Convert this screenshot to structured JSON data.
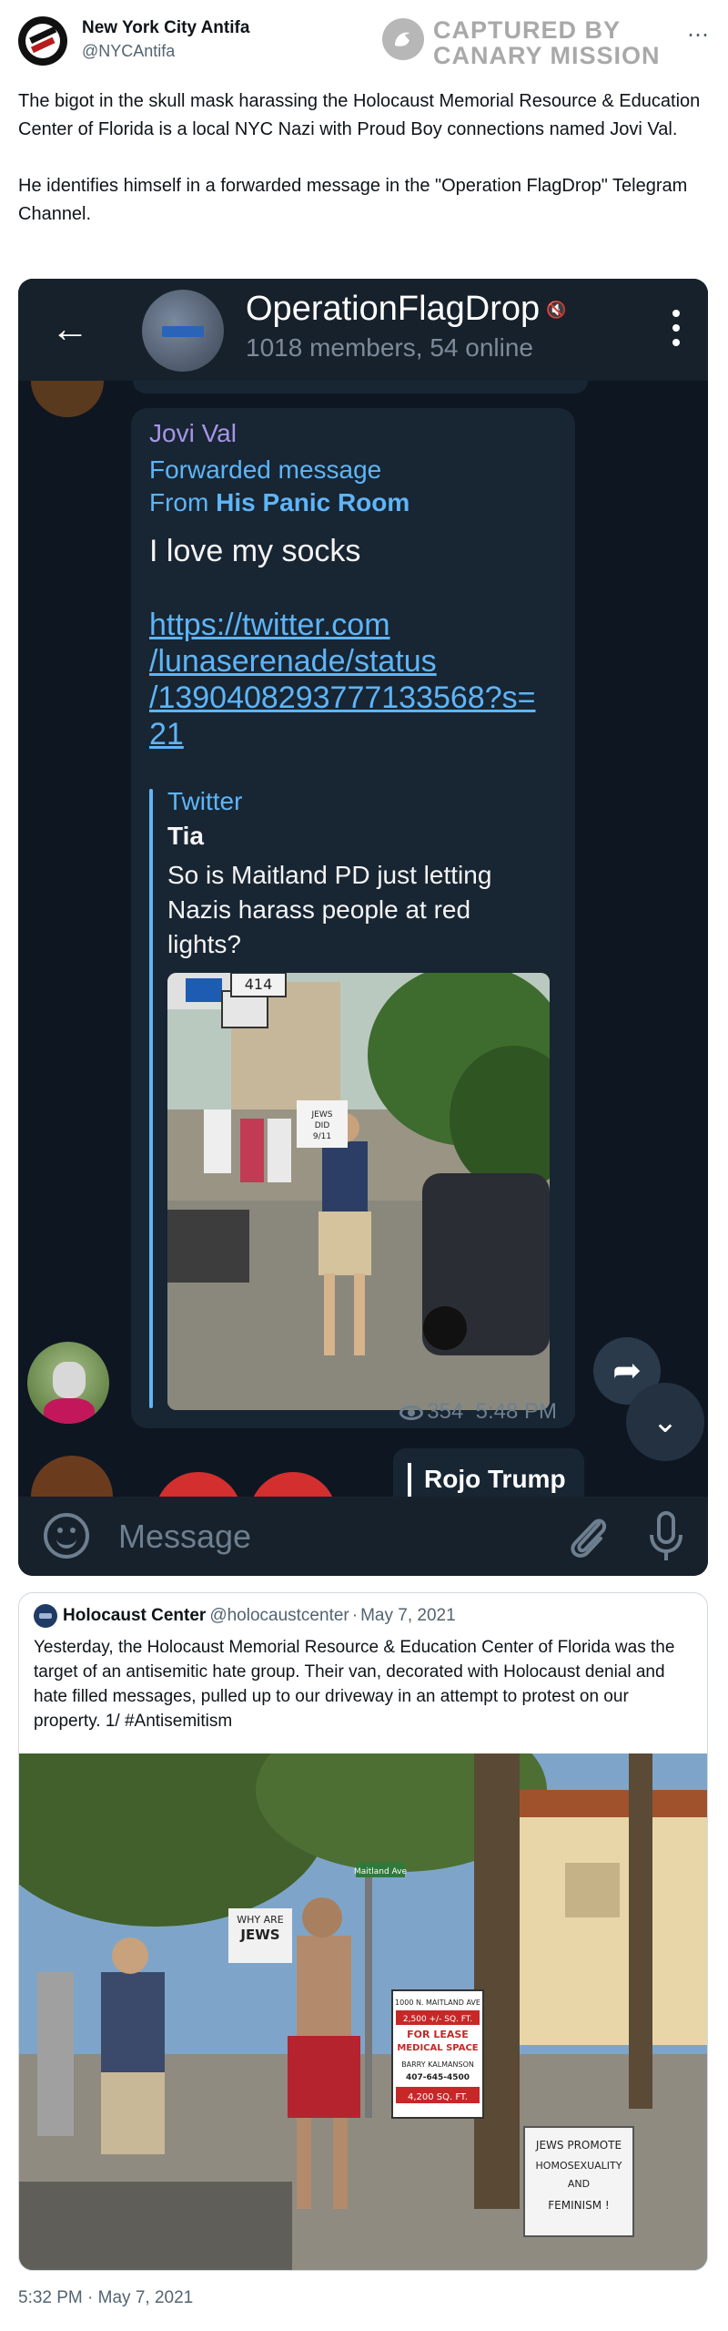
{
  "tweet": {
    "author_name": "New York City Antifa",
    "author_handle": "@NYCAntifa",
    "watermark_line1": "CAPTURED BY",
    "watermark_line2": "CANARY MISSION",
    "more_icon": "more-horizontal-icon",
    "paragraph1": "The bigot in the skull mask harassing the Holocaust Memorial Resource & Education Center of Florida is a local NYC Nazi with Proud Boy connections named Jovi Val.",
    "paragraph2": "He identifies himself in a forwarded message in the \"Operation FlagDrop\" Telegram Channel.",
    "time": "5:32 PM",
    "date_sep": " · ",
    "date": "May 7, 2021"
  },
  "telegram": {
    "back_icon": "arrow-left-icon",
    "group_title": "OperationFlagDrop",
    "group_subtitle": "1018 members, 54 online",
    "message": {
      "sender": "Jovi Val",
      "forwarded_label": "Forwarded message",
      "from_prefix": "From ",
      "from_name": "His Panic Room",
      "text": "I love my socks",
      "link_lines": [
        "https://twitter.com",
        "/lunaserenade/status",
        "/1390408293777133568?s=",
        "21"
      ],
      "preview": {
        "site": "Twitter",
        "name": "Tia",
        "description": "So is Maitland PD just letting Nazis harass people at red lights?",
        "photo_sign_line1": "JEWS",
        "photo_sign_line2": "DID",
        "photo_sign_line3": "9/11",
        "photo_road_sign": "414"
      },
      "views": "354",
      "time": "5:48 PM"
    },
    "next_message_preview": "Rojo Trump",
    "input_placeholder": "Message",
    "icons": [
      "emoji-icon",
      "paperclip-icon",
      "microphone-icon",
      "share-icon",
      "chevron-down-icon",
      "mute-icon"
    ]
  },
  "quoted_tweet": {
    "name": "Holocaust Center",
    "handle": "@holocaustcenter",
    "separator": "·",
    "date": "May 7, 2021",
    "text": "Yesterday, the Holocaust Memorial Resource & Education Center of Florida was the target of an antisemitic hate group. Their van, decorated with Holocaust denial and hate filled messages, pulled up to our driveway in an attempt to protest on our property. 1/ #Antisemitism",
    "photo": {
      "sign_why": "WHY ARE",
      "sign_jews": "JEWS",
      "street_sign": "Maitland Ave",
      "lease_sign_line1": "1000 N. MAITLAND AVE",
      "lease_sign_line2": "2,500 +/- SQ. FT.",
      "lease_sign_line3": "FOR LEASE",
      "lease_sign_line4": "MEDICAL SPACE",
      "lease_sign_line5": "BARRY KALMANSON",
      "lease_sign_line6": "407-645-4500",
      "lease_sign_line7": "4,200 SQ. FT.",
      "hand_sign_line1": "JEWS PROMOTE",
      "hand_sign_line2": "HOMOSEXUALITY",
      "hand_sign_line3": "AND",
      "hand_sign_line4": "FEMINISM !"
    }
  }
}
